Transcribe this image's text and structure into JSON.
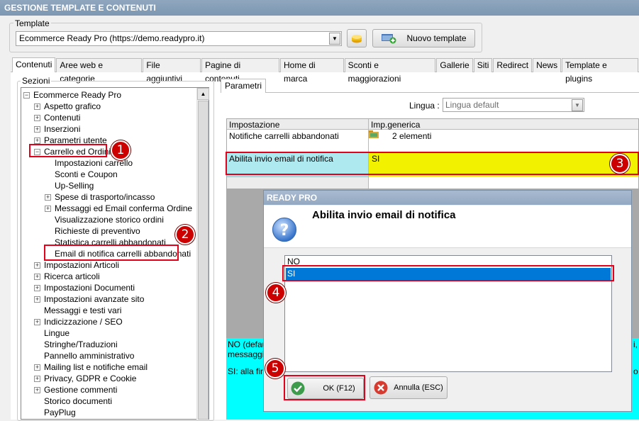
{
  "window_title": "GESTIONE TEMPLATE E CONTENUTI",
  "template": {
    "legend": "Template",
    "selected": "Ecommerce Ready Pro (https://demo.readypro.it)",
    "new_button": "Nuovo template"
  },
  "tabs": [
    "Contenuti",
    "Aree web e categorie",
    "File aggiuntivi",
    "Pagine di contenuti",
    "Home di marca",
    "Sconti e maggiorazioni",
    "Gallerie",
    "Siti",
    "Redirect",
    "News",
    "Template e plugins"
  ],
  "sezioni": {
    "legend": "Sezioni",
    "tree": [
      "Ecommerce Ready Pro",
      "Aspetto grafico",
      "Contenuti",
      "Inserzioni",
      "Parametri utente",
      "Carrello ed Ordini",
      "Impostazioni carrello",
      "Sconti e Coupon",
      "Up-Selling",
      "Spese di trasporto/incasso",
      "Messaggi ed Email conferma Ordine",
      "Visualizzazione storico ordini",
      "Richieste di preventivo",
      "Statistica carrelli abbandonati",
      "Email di notifica carrelli abbandonati",
      "Impostazioni Articoli",
      "Ricerca articoli",
      "Impostazioni Documenti",
      "Impostazioni avanzate sito",
      "Messaggi e testi vari",
      "Indicizzazione / SEO",
      "Lingue",
      "Stringhe/Traduzioni",
      "Pannello amministrativo",
      "Mailing list e notifiche email",
      "Privacy, GDPR e Cookie",
      "Gestione commenti",
      "Storico documenti",
      "PayPlug"
    ]
  },
  "parametri": {
    "tab": "Parametri",
    "lingua_label": "Lingua :",
    "lingua_value": "Lingua default",
    "col_impostazione": "Impostazione",
    "col_generica": "Imp.generica",
    "row1_label": "Notifiche carrelli abbandonati",
    "row1_value": "2 elementi",
    "row2_label": "Abilita invio email di notifica",
    "row2_value": "SI",
    "desc_line1": "NO (defau",
    "desc_line2": "messaggi d",
    "desc_line3": "SI: alla fine",
    "desc_right1": "i,",
    "desc_right2": "o"
  },
  "dialog": {
    "title": "READY PRO",
    "question": "Abilita invio email di notifica",
    "options": [
      "NO",
      "SI"
    ],
    "ok_label": "OK (F12)",
    "cancel_label": "Annulla (ESC)"
  },
  "badges": [
    "1",
    "2",
    "3",
    "4",
    "5"
  ],
  "colors": {
    "highlight_red": "#e2001a",
    "badge_red": "#cc0000",
    "selected_row_yellow": "#f2f200",
    "label_cyan": "#aee9f0",
    "list_selection_blue": "#0078d7",
    "description_cyan": "#00ffff"
  }
}
